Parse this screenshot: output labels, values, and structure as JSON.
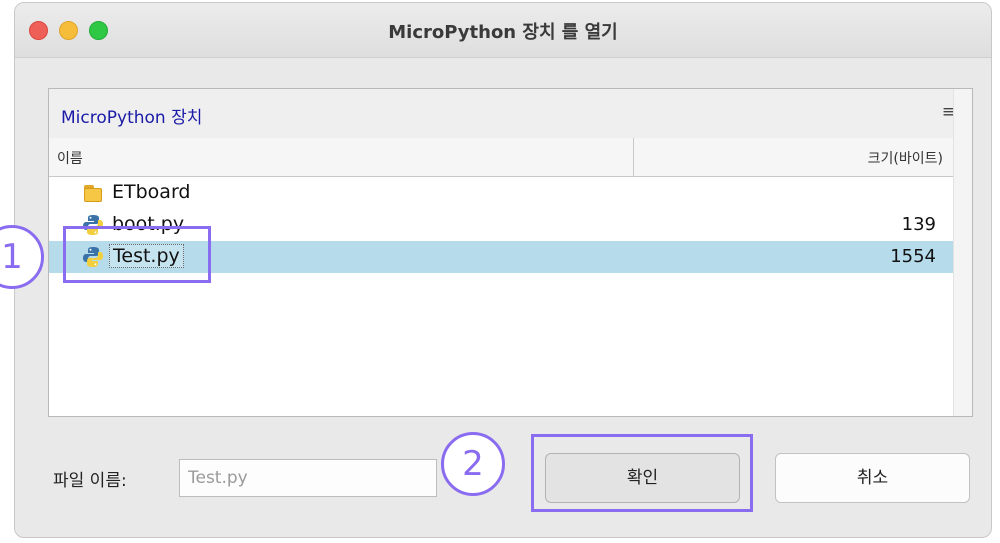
{
  "window": {
    "title": "MicroPython 장치 를 열기"
  },
  "panel": {
    "title": "MicroPython 장치",
    "menu_icon": "≡"
  },
  "columns": {
    "name": "이름",
    "size": "크기(바이트)"
  },
  "files": [
    {
      "name": "ETboard",
      "size": "",
      "icon": "folder-icon"
    },
    {
      "name": "boot.py",
      "size": "139",
      "icon": "python-file-icon"
    },
    {
      "name": "Test.py",
      "size": "1554",
      "icon": "python-file-icon",
      "selected": true
    }
  ],
  "filename_field": {
    "label": "파일 이름:",
    "value": "Test.py"
  },
  "buttons": {
    "ok": "확인",
    "cancel": "취소"
  },
  "annotations": {
    "step1": "1",
    "step2": "2"
  },
  "colors": {
    "selection": "#b6dcec",
    "annotation": "#8a6cf0",
    "panel_title": "#1a1aa8"
  }
}
